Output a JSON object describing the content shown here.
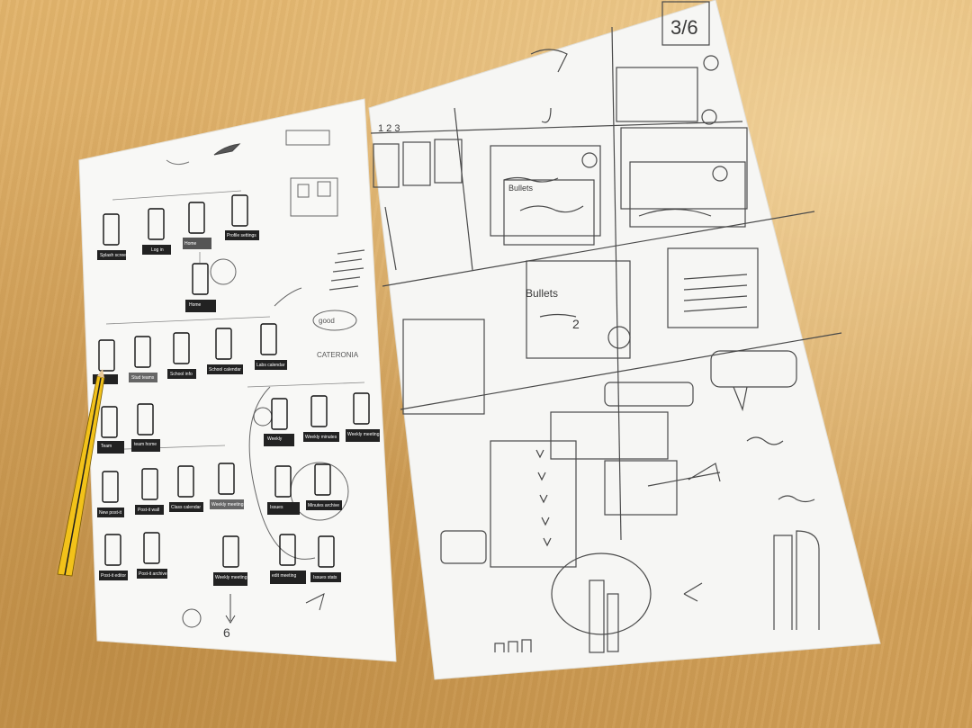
{
  "flow_labels": {
    "splash": "Splash screen",
    "login": "Log in",
    "home1": "Home\nMain options",
    "profile": "Profile settings",
    "home2": "Home\nMain options",
    "students": "Stud teams",
    "school_info": "School info",
    "school_calendar": "School calendar",
    "labs_calendar": "Labs calendar",
    "team_mgmt": "Team\nmanagement",
    "team_home": "team home\nMain options",
    "weekly_issues": "Weekly\nissues list",
    "weekly_minutes": "Weekly minutes",
    "weekly_archive": "Weekly meeting\narchive",
    "new_postit": "New post-it",
    "postit_wall": "Post-it wall",
    "class_calendar": "Class calendar",
    "weekly_meeting": "Weekly meeting",
    "issues_suggestions": "Issues\nsuggestions",
    "minutes_archive": "Minutes archive",
    "postit_editor": "Post-it editor",
    "postit_archive": "Post-it archive",
    "weekly_settings": "Weekly meeting\nsettings",
    "edit_meeting": "edit meeting\nsuggestions",
    "issues_stats": "Issues stats"
  },
  "handwriting": {
    "catalonia": "CATERONIA",
    "good": "good",
    "page_count": "3/6",
    "number_six": "6",
    "bullet_label": "Bullets",
    "numbers": "1 2 3",
    "two": "2"
  },
  "colors": {
    "desk": "#d9a85e",
    "paper": "#f7f7f5",
    "ink": "#3a3a3a",
    "pencil_yellow": "#f2c21a"
  }
}
